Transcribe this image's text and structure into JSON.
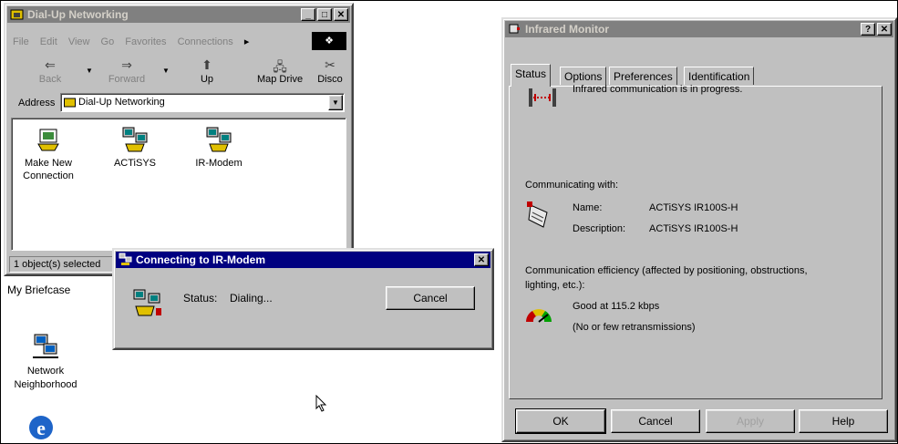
{
  "dialup": {
    "title": "Dial-Up Networking",
    "menu": [
      "File",
      "Edit",
      "View",
      "Go",
      "Favorites",
      "Connections"
    ],
    "toolbar": {
      "back": "Back",
      "forward": "Forward",
      "up": "Up",
      "map_drive": "Map Drive",
      "disconnect": "Disco"
    },
    "address_label": "Address",
    "address_value": "Dial-Up Networking",
    "items": [
      {
        "label_line1": "Make New",
        "label_line2": "Connection"
      },
      {
        "label_line1": "ACTiSYS",
        "label_line2": ""
      },
      {
        "label_line1": "IR-Modem",
        "label_line2": ""
      }
    ],
    "status_bar": "1 object(s) selected"
  },
  "desktop": {
    "briefcase": "My Briefcase",
    "network_line1": "Network",
    "network_line2": "Neighborhood"
  },
  "connecting": {
    "title": "Connecting to IR-Modem",
    "status_label": "Status:",
    "status_value": "Dialing...",
    "cancel": "Cancel"
  },
  "infrared": {
    "title": "Infrared Monitor",
    "tabs": [
      "Status",
      "Options",
      "Preferences",
      "Identification"
    ],
    "message": "Infrared communication is in progress.",
    "communicating_with": "Communicating with:",
    "name_label": "Name:",
    "name_value": "ACTiSYS IR100S-H",
    "description_label": "Description:",
    "description_value": "ACTiSYS IR100S-H",
    "efficiency_line1": "Communication efficiency (affected by positioning, obstructions,",
    "efficiency_line2": "lighting, etc.):",
    "speed": "Good at 115.2 kbps",
    "retrans": "(No or few retransmissions)",
    "buttons": {
      "ok": "OK",
      "cancel": "Cancel",
      "apply": "Apply",
      "help": "Help"
    }
  },
  "colors": {
    "active_title": "#000080",
    "inactive_title": "#808080",
    "face": "#c0c0c0"
  }
}
